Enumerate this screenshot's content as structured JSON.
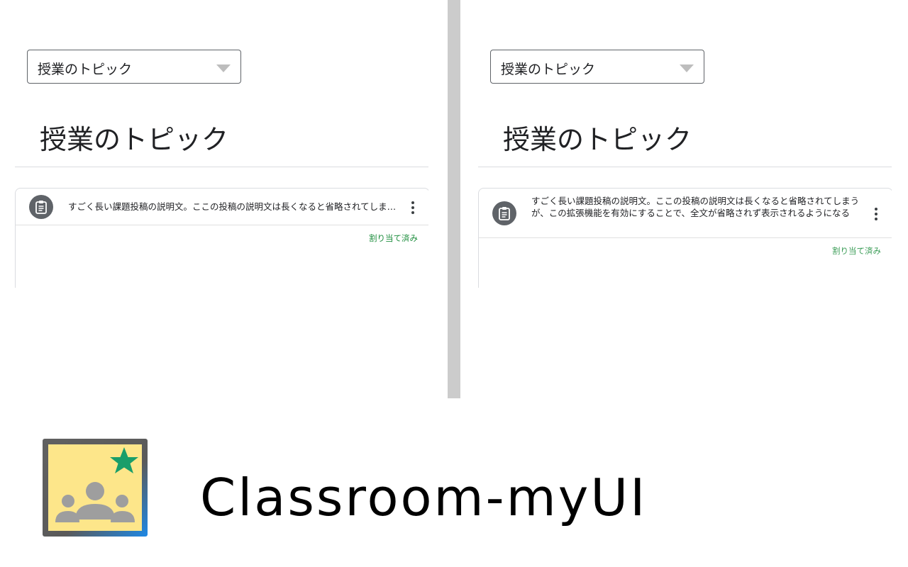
{
  "left_panel": {
    "topic_select": {
      "value": "授業のトピック"
    },
    "topic_heading": "授業のトピック",
    "post": {
      "text": "すごく長い課題投稿の説明文。ここの投稿の説明文は長くなると省略されてしまうが、この拡張機能を有効にすることで、全文が省略されず表示されるようになる",
      "status": "割り当て済み"
    }
  },
  "right_panel": {
    "topic_select": {
      "value": "授業のトピック"
    },
    "topic_heading": "授業のトピック",
    "post": {
      "text": "すごく長い課題投稿の説明文。ここの投稿の説明文は長くなると省略されてしまうが、この拡張機能を有効にすることで、全文が省略されず表示されるようになる",
      "status": "割り当て済み"
    }
  },
  "branding": {
    "app_name": "Classroom-myUI",
    "logo_icon": "google-classroom-star-icon"
  },
  "colors": {
    "divider": "#cccccc",
    "status_green": "#1e8e3e",
    "icon_gray": "#5f6368",
    "logo_yellow": "#fde68a",
    "logo_star": "#1a9e6a",
    "logo_border_blue": "#1e88e5"
  }
}
